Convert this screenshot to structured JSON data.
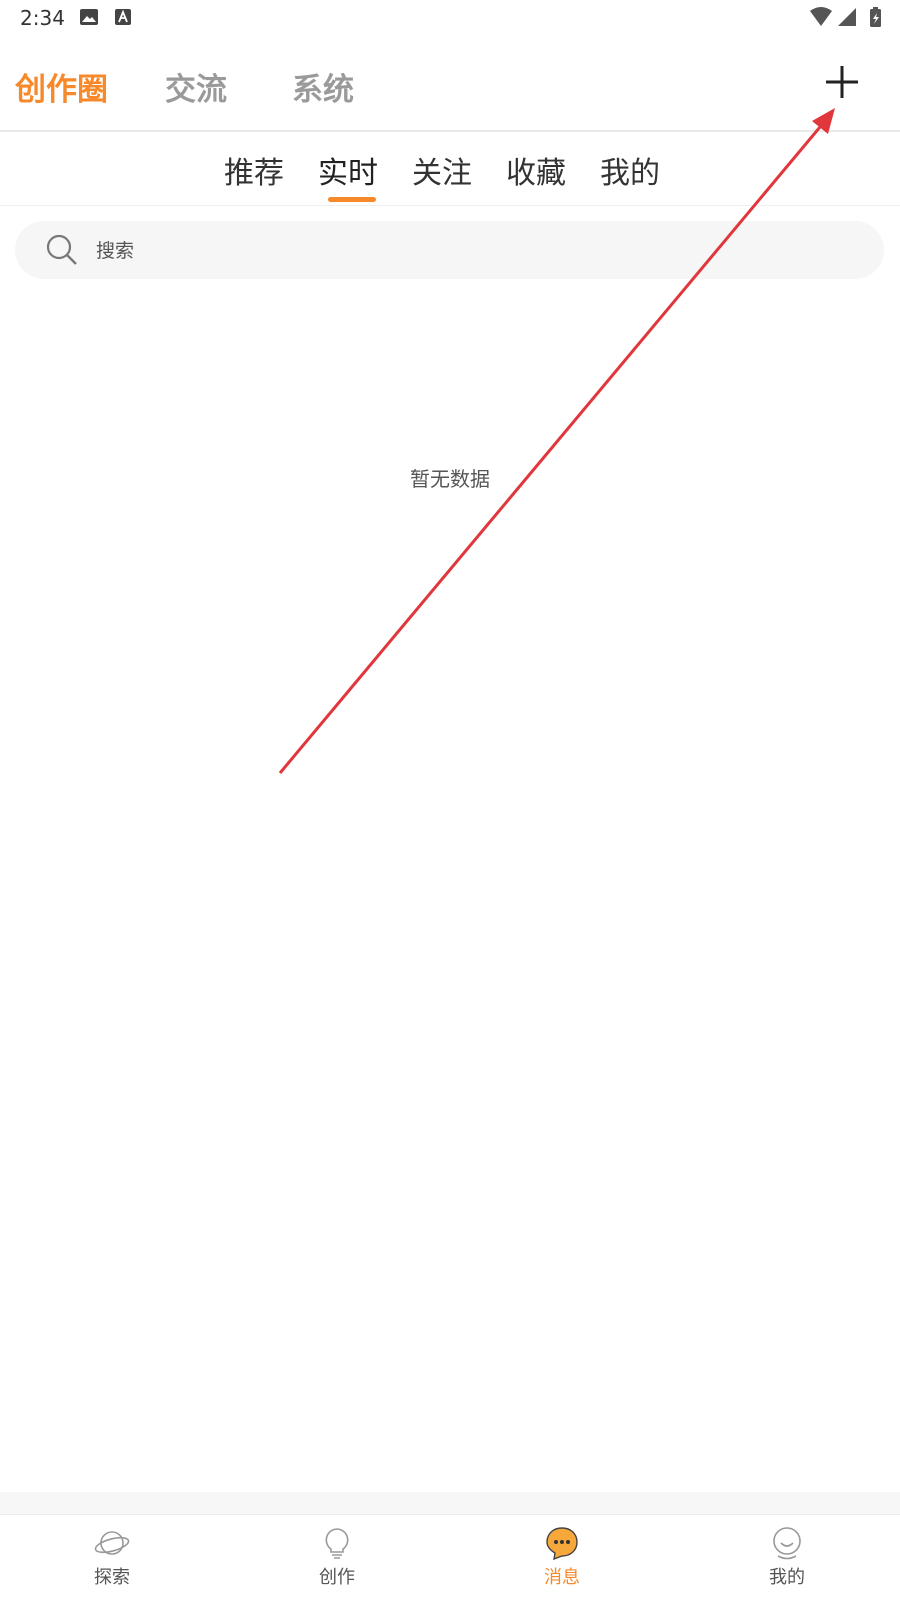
{
  "status_bar": {
    "time": "2:34",
    "icons": [
      "image-icon",
      "a-icon",
      "wifi-icon",
      "signal-icon",
      "battery-icon"
    ]
  },
  "top_tabs": [
    {
      "label": "创作圈",
      "active": true
    },
    {
      "label": "交流",
      "active": false
    },
    {
      "label": "系统",
      "active": false
    }
  ],
  "add_button": {
    "icon": "plus-icon"
  },
  "sub_tabs": [
    {
      "label": "推荐",
      "active": false
    },
    {
      "label": "实时",
      "active": true
    },
    {
      "label": "关注",
      "active": false
    },
    {
      "label": "收藏",
      "active": false
    },
    {
      "label": "我的",
      "active": false
    }
  ],
  "search": {
    "placeholder": "搜索",
    "value": ""
  },
  "empty_state": {
    "text": "暂无数据"
  },
  "bottom_nav": [
    {
      "label": "探索",
      "icon": "planet-icon",
      "active": false
    },
    {
      "label": "创作",
      "icon": "lightbulb-icon",
      "active": false
    },
    {
      "label": "消息",
      "icon": "chat-bubble-icon",
      "active": true
    },
    {
      "label": "我的",
      "icon": "user-icon",
      "active": false
    }
  ],
  "colors": {
    "accent": "#f7892b",
    "annotation_arrow": "#e0363c"
  }
}
